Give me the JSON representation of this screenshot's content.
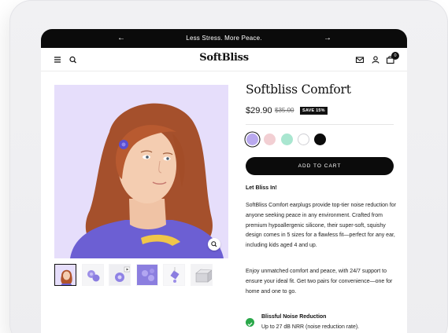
{
  "announcement": {
    "text": "Less Stress. More Peace.",
    "prev_icon": "arrow-left-icon",
    "next_icon": "arrow-right-icon"
  },
  "header": {
    "logo": "SoftBliss",
    "icons": [
      "menu-icon",
      "search-icon",
      "mail-icon",
      "user-icon",
      "cart-icon"
    ],
    "cart_count": "0"
  },
  "product": {
    "title": "Softbliss Comfort",
    "price": "$29.90",
    "compare_price": "$35.00",
    "save_badge": "SAVE 15%",
    "swatches": [
      {
        "color": "#b9a9ee",
        "selected": true
      },
      {
        "color": "#f2cfd3",
        "selected": false
      },
      {
        "color": "#a9e6d0",
        "selected": false
      },
      {
        "color": "#ffffff",
        "selected": false
      },
      {
        "color": "#0b0b0b",
        "selected": false
      }
    ],
    "add_to_cart": "ADD TO CART",
    "tagline": "Let Bliss In!",
    "description_1": "SoftBliss Comfort earplugs provide top-tier noise reduction for anyone seeking peace in any environment. Crafted from premium hypoallergenic silicone, their super-soft, squishy design comes in 5 sizes for a flawless fit—perfect for any ear, including kids aged 4 and up.",
    "description_2": "Enjoy unmatched comfort and peace, with 24/7 support to ensure your ideal fit. Get two pairs for convenience—one for home and one to go.",
    "feature": {
      "title": "Blissful Noise Reduction",
      "description": "Up to 27 dB NRR (noise reduction rate)."
    }
  },
  "gallery": {
    "thumbnails": 6,
    "active_index": 0,
    "zoom_icon": "zoom-icon"
  },
  "colors": {
    "accent": "#b9a9ee",
    "image_bg": "#e4dcfa",
    "check": "#2aa84a"
  }
}
